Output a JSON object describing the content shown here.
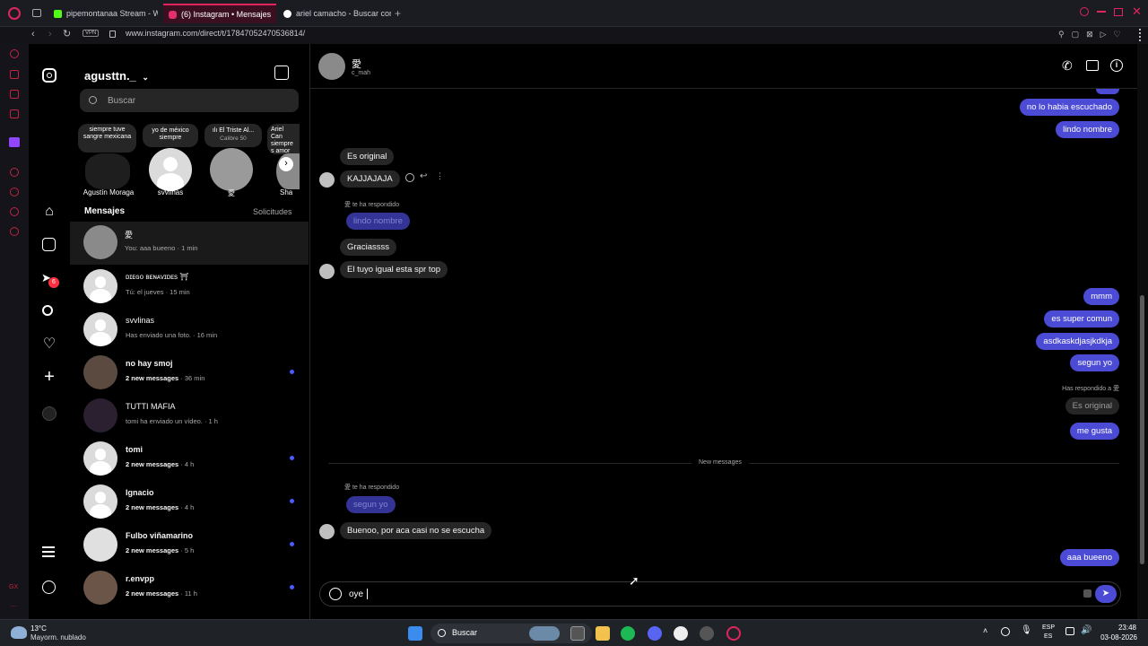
{
  "browser": {
    "tabs": [
      {
        "label": "pipemontanaa Stream - Wa",
        "color": "#53fc18"
      },
      {
        "label": "(6) Instagram • Mensajes",
        "color": "#e1306c"
      },
      {
        "label": "ariel camacho - Buscar con",
        "color": "#4285f4"
      }
    ],
    "vpn_label": "VPN",
    "url": "www.instagram.com/direct/t/17847052470536814/"
  },
  "instagram": {
    "account": "agusttn._",
    "search_placeholder": "Buscar",
    "notes": [
      {
        "note": "siempre tuve sangre mexicana",
        "name": "Agustín Moraga"
      },
      {
        "note": "yo de méxico siempre",
        "name": "svvlinas"
      },
      {
        "note": "ılı El Triste Al...",
        "sub": "Calibre 50",
        "name": "愛"
      },
      {
        "note": "Ariel Can siempre s amor pla",
        "name": "Sha"
      }
    ],
    "messages_header": "Mensajes",
    "requests_label": "Solicitudes",
    "nav_badge": "6",
    "conversations": [
      {
        "name": "愛",
        "sub": "You: aaa bueeno · 1 min",
        "unread": false
      },
      {
        "name": "ᴅɪᴇɢᴏ ʙᴇɴᴀᴠɪᴅᴇs ⛩",
        "sub": "Tú: el jueves · 15 min",
        "unread": false
      },
      {
        "name": "svvlinas",
        "sub": "Has enviado una foto. · 16 min",
        "unread": false
      },
      {
        "name": "no hay smoj",
        "bold": "2 new messages",
        "time": " · 36 min",
        "unread": true
      },
      {
        "name": "TUTTI MAFIA",
        "sub": "tomi ha enviado un vídeo. · 1 h",
        "unread": false
      },
      {
        "name": "tomi",
        "bold": "2 new messages",
        "time": " · 4 h",
        "unread": true
      },
      {
        "name": "Ignacio",
        "bold": "2 new messages",
        "time": " · 4 h",
        "unread": true
      },
      {
        "name": "Fulbo viñamarino",
        "bold": "2 new messages",
        "time": " · 5 h",
        "unread": true
      },
      {
        "name": "r.envpp",
        "bold": "2 new messages",
        "time": " · 11 h",
        "unread": true
      }
    ],
    "chat": {
      "name": "愛",
      "username": "c_mah",
      "msgs": {
        "out1": "no lo habia escuchado",
        "out2": "lindo nombre",
        "in1": "Es original",
        "in2": "KAJJAJAJA",
        "reply_label1": "愛 te ha respondido",
        "reply_quote1": "lindo nombre",
        "in3": "Graciassss",
        "in4": "El tuyo igual esta spr top",
        "out3": "mmm",
        "out4": "es super comun",
        "out5": "asdkaskdjasjkdkja",
        "out6": "segun yo",
        "reply_label2": "Has respondido a 愛",
        "reply_quote2": "Es original",
        "out7": "me gusta",
        "divider": "New messages",
        "reply_label3": "愛 te ha respondido",
        "reply_quote3": "segun yo",
        "in5": "Buenoo, por aca casi no se escucha",
        "out8": "aaa bueeno"
      },
      "composer_value": "oye"
    }
  },
  "taskbar": {
    "weather_temp": "13°C",
    "weather_desc": "Mayorm. nublado",
    "search_label": "Buscar",
    "lang1": "ESP",
    "lang2": "ES",
    "time": "23:48",
    "date": "03-08-2026"
  },
  "colors": {
    "accent": "#4b4bd6",
    "opera_red": "#e0245e"
  }
}
